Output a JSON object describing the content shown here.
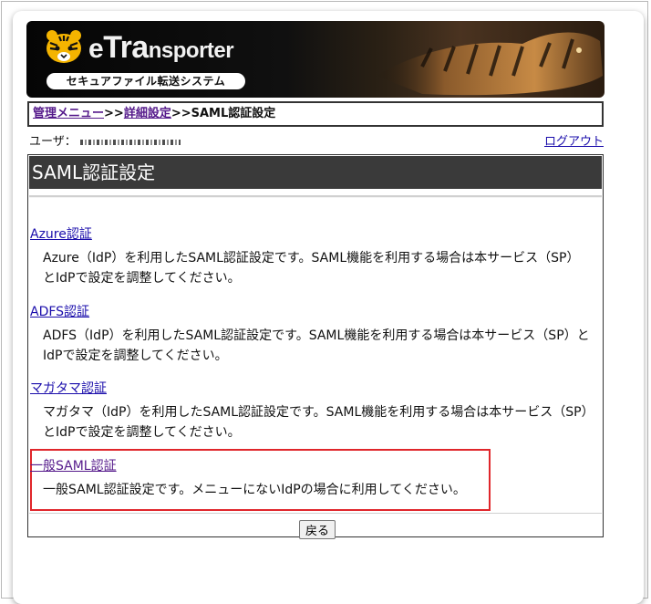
{
  "header": {
    "logo_text_e": "e",
    "logo_text_rest": "Tra",
    "logo_text_tail": "nsporter",
    "logo_subtitle": "セキュアファイル転送システム"
  },
  "breadcrumb": {
    "item1": "管理メニュー",
    "sep1": ">>",
    "item2": "詳細設定",
    "sep2": ">>",
    "current": "SAML認証設定"
  },
  "user": {
    "label": "ユーザ：",
    "logout": "ログアウト"
  },
  "page": {
    "title": "SAML認証設定"
  },
  "sections": [
    {
      "link": "Azure認証",
      "desc": "Azure（IdP）を利用したSAML認証設定です。SAML機能を利用する場合は本サービス（SP）とIdPで設定を調整してください。"
    },
    {
      "link": "ADFS認証",
      "desc": "ADFS（IdP）を利用したSAML認証設定です。SAML機能を利用する場合は本サービス（SP）とIdPで設定を調整してください。"
    },
    {
      "link": "マガタマ認証",
      "desc": "マガタマ（IdP）を利用したSAML認証設定です。SAML機能を利用する場合は本サービス（SP）とIdPで設定を調整してください。"
    },
    {
      "link": "一般SAML認証",
      "desc": "一般SAML認証設定です。メニューにないIdPの場合に利用してください。"
    }
  ],
  "buttons": {
    "back": "戻る"
  },
  "colors": {
    "title_bar": "#3a3a3a",
    "highlight": "#e0262b",
    "link": "#1a0dab",
    "visited_link": "#551a8b"
  }
}
